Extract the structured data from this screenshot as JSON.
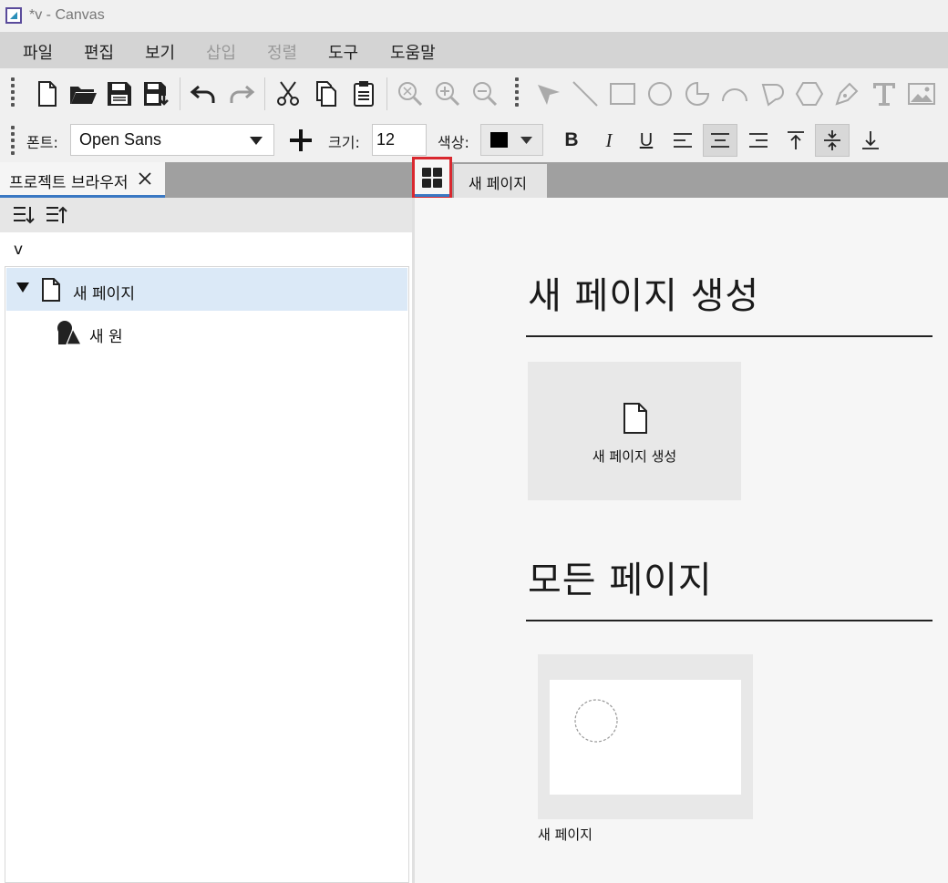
{
  "window": {
    "title": "*v - Canvas"
  },
  "menu": {
    "items": [
      {
        "label": "파일",
        "enabled": true
      },
      {
        "label": "편집",
        "enabled": true
      },
      {
        "label": "보기",
        "enabled": true
      },
      {
        "label": "삽입",
        "enabled": false
      },
      {
        "label": "정렬",
        "enabled": false
      },
      {
        "label": "도구",
        "enabled": true
      },
      {
        "label": "도움말",
        "enabled": true
      }
    ]
  },
  "format": {
    "font_label": "폰트:",
    "font_value": "Open Sans",
    "size_label": "크기:",
    "size_value": "12",
    "color_label": "색상:",
    "color_value": "#000000",
    "bold": "B",
    "italic": "I",
    "underline": "U"
  },
  "left_panel": {
    "tab_label": "프로젝트 브라우저",
    "project_name": "v",
    "tree": {
      "page_label": "새 페이지",
      "child_label": "새 원"
    }
  },
  "editor": {
    "tab_label": "새 페이지",
    "create_heading": "새 페이지 생성",
    "create_card_label": "새 페이지 생성",
    "all_pages_heading": "모든 페이지",
    "page_thumb_label": "새 페이지"
  },
  "colors": {
    "highlight_border": "#d9282f",
    "selection": "#dbe9f7",
    "tab_underline": "#3a78c3"
  }
}
